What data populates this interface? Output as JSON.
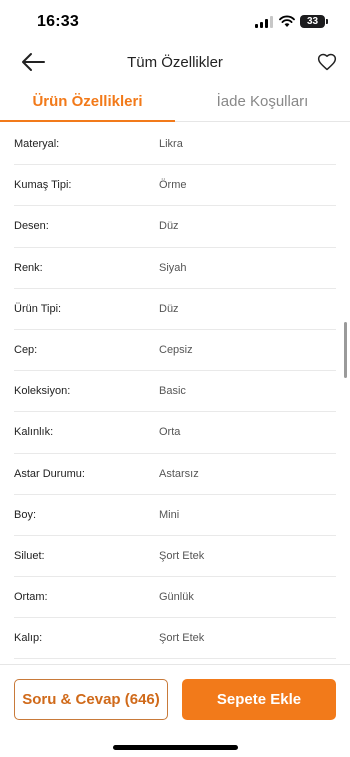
{
  "status": {
    "time": "16:33",
    "battery": "33"
  },
  "nav": {
    "title": "Tüm Özellikler",
    "back_icon": "arrow-left-icon",
    "favorite_icon": "heart-outline-icon"
  },
  "tabs": [
    {
      "label": "Ürün Özellikleri",
      "active": true
    },
    {
      "label": "İade Koşulları",
      "active": false
    }
  ],
  "attributes": [
    {
      "name": "Materyal:",
      "value": "Likra"
    },
    {
      "name": "Kumaş Tipi:",
      "value": "Örme"
    },
    {
      "name": "Desen:",
      "value": "Düz"
    },
    {
      "name": "Renk:",
      "value": "Siyah"
    },
    {
      "name": "Ürün Tipi:",
      "value": "Düz"
    },
    {
      "name": "Cep:",
      "value": "Cepsiz"
    },
    {
      "name": "Koleksiyon:",
      "value": "Basic"
    },
    {
      "name": "Kalınlık:",
      "value": "Orta"
    },
    {
      "name": "Astar Durumu:",
      "value": "Astarsız"
    },
    {
      "name": "Boy:",
      "value": "Mini"
    },
    {
      "name": "Siluet:",
      "value": "Şort Etek"
    },
    {
      "name": "Ortam:",
      "value": "Günlük"
    },
    {
      "name": "Kalıp:",
      "value": "Şort Etek"
    }
  ],
  "actions": {
    "qa_label": "Soru & Cevap (646)",
    "cart_label": "Sepete Ekle"
  },
  "colors": {
    "accent": "#f27a1a",
    "divider": "#e9e9e9"
  }
}
